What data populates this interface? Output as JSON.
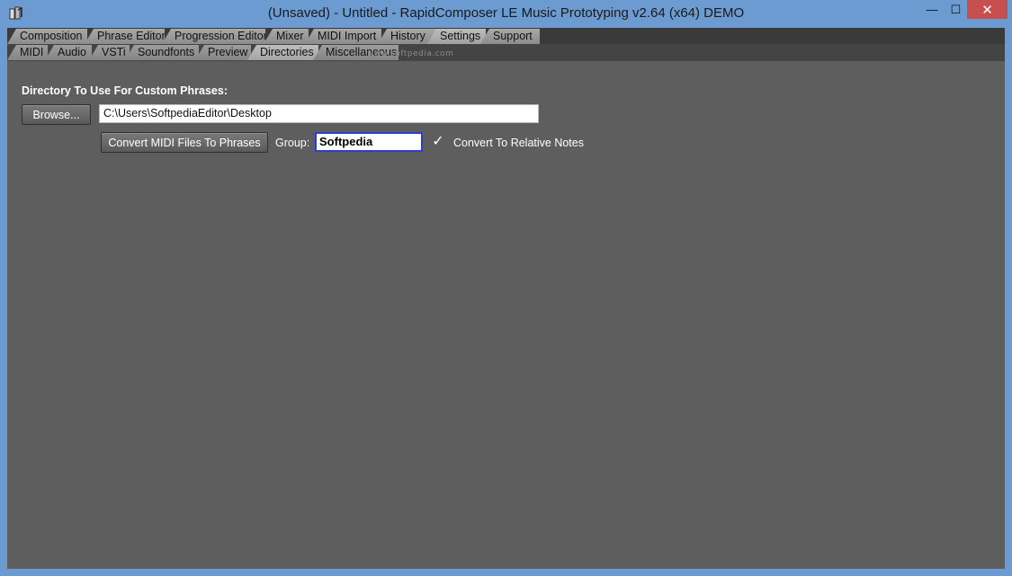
{
  "window": {
    "title": "(Unsaved) - Untitled - RapidComposer LE Music Prototyping v2.64 (x64) DEMO",
    "icon": "app-icon",
    "controls": {
      "minimize": "—",
      "maximize": "☐",
      "close": "✕"
    }
  },
  "main_tabs": [
    {
      "label": "Composition"
    },
    {
      "label": "Phrase Editor"
    },
    {
      "label": "Progression Editor"
    },
    {
      "label": "Mixer"
    },
    {
      "label": "MIDI Import"
    },
    {
      "label": "History"
    },
    {
      "label": "Settings",
      "active": true
    },
    {
      "label": "Support"
    }
  ],
  "sub_tabs": [
    {
      "label": "MIDI"
    },
    {
      "label": "Audio"
    },
    {
      "label": "VSTi"
    },
    {
      "label": "Soundfonts"
    },
    {
      "label": "Preview"
    },
    {
      "label": "Directories",
      "active": true
    },
    {
      "label": "Miscellaneous"
    }
  ],
  "watermark": "www.softpedia.com",
  "directories": {
    "section_label": "Directory To Use For Custom Phrases:",
    "browse_label": "Browse...",
    "path_value": "C:\\Users\\SoftpediaEditor\\Desktop",
    "convert_label": "Convert MIDI Files To Phrases",
    "group_label": "Group:",
    "group_value": "Softpedia",
    "relative_notes_checked": true,
    "relative_notes_label": "Convert To Relative Notes"
  },
  "colors": {
    "titlebar": "#6b9bd1",
    "client_bg": "#5e5e5e",
    "close_button": "#c74f4f",
    "focus_border": "#2a3fcf"
  }
}
